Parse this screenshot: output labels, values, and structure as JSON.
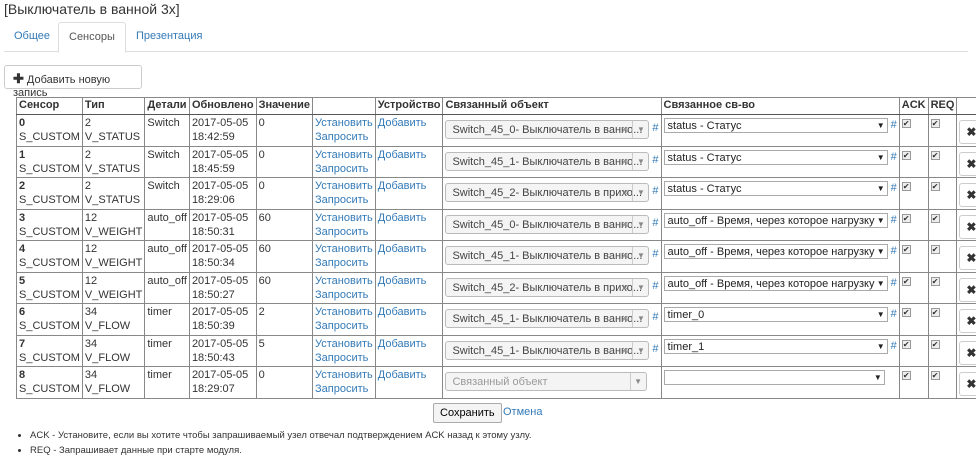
{
  "title": "[Выключатель в ванной 3х]",
  "tabs": [
    {
      "label": "Общее"
    },
    {
      "label": "Сенсоры",
      "active": true
    },
    {
      "label": "Презентация"
    }
  ],
  "add_button": "Добавить новую запись",
  "columns": [
    "Сенсор",
    "Тип",
    "Детали",
    "Обновлено",
    "Значение",
    "",
    "Устройство",
    "Связанный объект",
    "Связанное св-во",
    "ACK",
    "REQ",
    ""
  ],
  "links": {
    "set": "Установить",
    "request": "Запросить",
    "add": "Добавить"
  },
  "object_placeholder": "Связанный объект",
  "rows": [
    {
      "id": "0",
      "sensor": "S_CUSTOM",
      "type_num": "2",
      "type": "V_STATUS",
      "details": "Switch",
      "updated": "2017-05-05 18:42:59",
      "value": "0",
      "object": "Switch_45_0- Выключатель в ванно...",
      "property": "status - Статус",
      "ack": true,
      "req": true
    },
    {
      "id": "1",
      "sensor": "S_CUSTOM",
      "type_num": "2",
      "type": "V_STATUS",
      "details": "Switch",
      "updated": "2017-05-05 18:45:59",
      "value": "0",
      "object": "Switch_45_1- Выключатель в ванно...",
      "property": "status - Статус",
      "ack": true,
      "req": true
    },
    {
      "id": "2",
      "sensor": "S_CUSTOM",
      "type_num": "2",
      "type": "V_STATUS",
      "details": "Switch",
      "updated": "2017-05-05 18:29:06",
      "value": "0",
      "object": "Switch_45_2- Выключатель в прихо...",
      "property": "status - Статус",
      "ack": true,
      "req": true
    },
    {
      "id": "3",
      "sensor": "S_CUSTOM",
      "type_num": "12",
      "type": "V_WEIGHT",
      "details": "auto_off",
      "updated": "2017-05-05 18:50:31",
      "value": "60",
      "object": "Switch_45_0- Выключатель в ванно...",
      "property": "auto_off - Время, через которое нагрузку а",
      "ack": true,
      "req": true
    },
    {
      "id": "4",
      "sensor": "S_CUSTOM",
      "type_num": "12",
      "type": "V_WEIGHT",
      "details": "auto_off",
      "updated": "2017-05-05 18:50:34",
      "value": "60",
      "object": "Switch_45_1- Выключатель в ванно...",
      "property": "auto_off - Время, через которое нагрузку а",
      "ack": true,
      "req": true
    },
    {
      "id": "5",
      "sensor": "S_CUSTOM",
      "type_num": "12",
      "type": "V_WEIGHT",
      "details": "auto_off",
      "updated": "2017-05-05 18:50:27",
      "value": "60",
      "object": "Switch_45_2- Выключатель в прихо...",
      "property": "auto_off - Время, через которое нагрузку а",
      "ack": true,
      "req": true
    },
    {
      "id": "6",
      "sensor": "S_CUSTOM",
      "type_num": "34",
      "type": "V_FLOW",
      "details": "timer",
      "updated": "2017-05-05 18:50:39",
      "value": "2",
      "object": "Switch_45_1- Выключатель в ванно...",
      "property": "timer_0",
      "ack": true,
      "req": true
    },
    {
      "id": "7",
      "sensor": "S_CUSTOM",
      "type_num": "34",
      "type": "V_FLOW",
      "details": "timer",
      "updated": "2017-05-05 18:50:43",
      "value": "5",
      "object": "Switch_45_1- Выключатель в ванно...",
      "property": "timer_1",
      "ack": true,
      "req": true
    },
    {
      "id": "8",
      "sensor": "S_CUSTOM",
      "type_num": "34",
      "type": "V_FLOW",
      "details": "timer",
      "updated": "2017-05-05 18:29:07",
      "value": "0",
      "object": "",
      "property": "",
      "ack": true,
      "req": true
    }
  ],
  "save": "Сохранить",
  "cancel": "Отмена",
  "notes": [
    "ACK - Установите, если вы хотите чтобы запрашиваемый узел отвечал подтверждением ACK назад к этому узлу.",
    "REQ - Запрашивает данные при старте модуля."
  ]
}
